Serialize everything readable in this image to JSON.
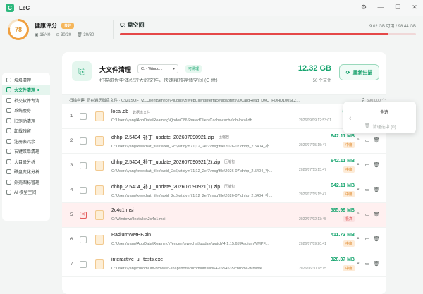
{
  "app": {
    "logo": "C",
    "title": "LeC"
  },
  "window_controls": [
    "gear-icon",
    "minimize-icon",
    "maximize-icon",
    "close-icon"
  ],
  "health": {
    "score": "78",
    "title": "健康评分",
    "badge": "良好",
    "stat1": "18/40",
    "stat2": "30/30",
    "stat3": "30/30"
  },
  "disk": {
    "title": "C: 盘空间",
    "size_text": "9.02 GB 可用 / 98.44 GB",
    "used_fraction": 0.908
  },
  "sidebar": {
    "items": [
      {
        "label": "垃圾清理",
        "active": false
      },
      {
        "label": "大文件清理",
        "active": true
      },
      {
        "label": "社交软件专清",
        "active": false
      },
      {
        "label": "系统瘦身",
        "active": false
      },
      {
        "label": "旧驱动清理",
        "active": false
      },
      {
        "label": "卸载残留",
        "active": false
      },
      {
        "label": "注册表冗余",
        "active": false
      },
      {
        "label": "右键菜单清理",
        "active": false
      },
      {
        "label": "大目录分析",
        "active": false
      },
      {
        "label": "磁盘变化分析",
        "active": false
      },
      {
        "label": "外壳图标管理",
        "active": false
      },
      {
        "label": "AI 模型空间",
        "active": false
      }
    ]
  },
  "header": {
    "title": "大文件清理",
    "drive_select": "C: · Windo...",
    "clean_badge": "可清理",
    "desc": "扫描磁盘中体积较大的文件，快速释放存储空间 (C 盘)",
    "total_size": "12.32 GB",
    "total_count": "50 个文件",
    "rescan_label": "重新扫描"
  },
  "scan": {
    "path": "扫描构建: 正在遍历磁盘文件 · C:\\ZLSOFT\\ZLClientService\\Plugins\\zlWebClientInterface\\adapters\\IDCardRead_DKQ_HDHD100SLZ...",
    "status": "完成",
    "count": "590,000 个文件"
  },
  "rows": [
    {
      "idx": "1",
      "name": "local.db",
      "tag": "数据库文件",
      "path": "C:\\Users\\yang\\AppData\\Roaming\\QoderCN\\SharedClientCache\\cache\\db\\local.db",
      "date": "2026/09/09 12:53:01",
      "size": "897.0",
      "risk": "",
      "selected": false
    },
    {
      "idx": "2",
      "name": "dhhp_2.5404_补丁_update_202607090921.zip",
      "tag": "压缩包",
      "path": "C:\\Users\\yang\\xwechat_files\\wxid_2c6jwtldym71j12_2ef7\\msg\\file\\2026-07\\dhhp_2.5404_补...",
      "date": "2026/07/15 15:47",
      "size": "642.11 MB",
      "risk": "中度",
      "selected": false
    },
    {
      "idx": "3",
      "name": "dhhp_2.5404_补丁_update_202607090921(2).zip",
      "tag": "压缩包",
      "path": "C:\\Users\\yang\\xwechat_files\\wxid_2c6jwtldym71j12_2ef7\\msg\\file\\2026-07\\dhhp_2.5404_补...",
      "date": "2026/07/15 15:47",
      "size": "642.11 MB",
      "risk": "中度",
      "selected": false
    },
    {
      "idx": "4",
      "name": "dhhp_2.5404_补丁_update_202607090921(1).zip",
      "tag": "压缩包",
      "path": "C:\\Users\\yang\\xwechat_files\\wxid_2c6jwtldym71j12_2ef7\\msg\\file\\2026-07\\dhhp_2.5404_补...",
      "date": "2026/07/15 15:47",
      "size": "642.11 MB",
      "risk": "中度",
      "selected": false
    },
    {
      "idx": "5",
      "name": "2c4c1.msi",
      "tag": "",
      "path": "C:\\Windows\\Installer\\2c4c1.msi",
      "date": "2022/07/02 13:45",
      "size": "585.99 MB",
      "risk": "极高",
      "selected": true
    },
    {
      "idx": "6",
      "name": "RadiumWMPF.bin",
      "tag": "",
      "path": "C:\\Users\\yang\\AppData\\Roaming\\Tencent\\xwechat\\update\\patch\\4.1.15.65\\RadiumWMPF....",
      "date": "2026/07/09 20:41",
      "size": "411.73 MB",
      "risk": "中度",
      "selected": false
    },
    {
      "idx": "7",
      "name": "interactive_ui_tests.exe",
      "tag": "",
      "path": "C:\\Users\\yang\\chromium-browser-snapshots\\chromium\\win64-1654535\\chrome-win\\inte...",
      "date": "2026/06/30 18:15",
      "size": "328.37 MB",
      "risk": "中度",
      "selected": false
    }
  ],
  "popup": {
    "select_all": "全选",
    "clear_selected": "清理选中 (0)"
  }
}
